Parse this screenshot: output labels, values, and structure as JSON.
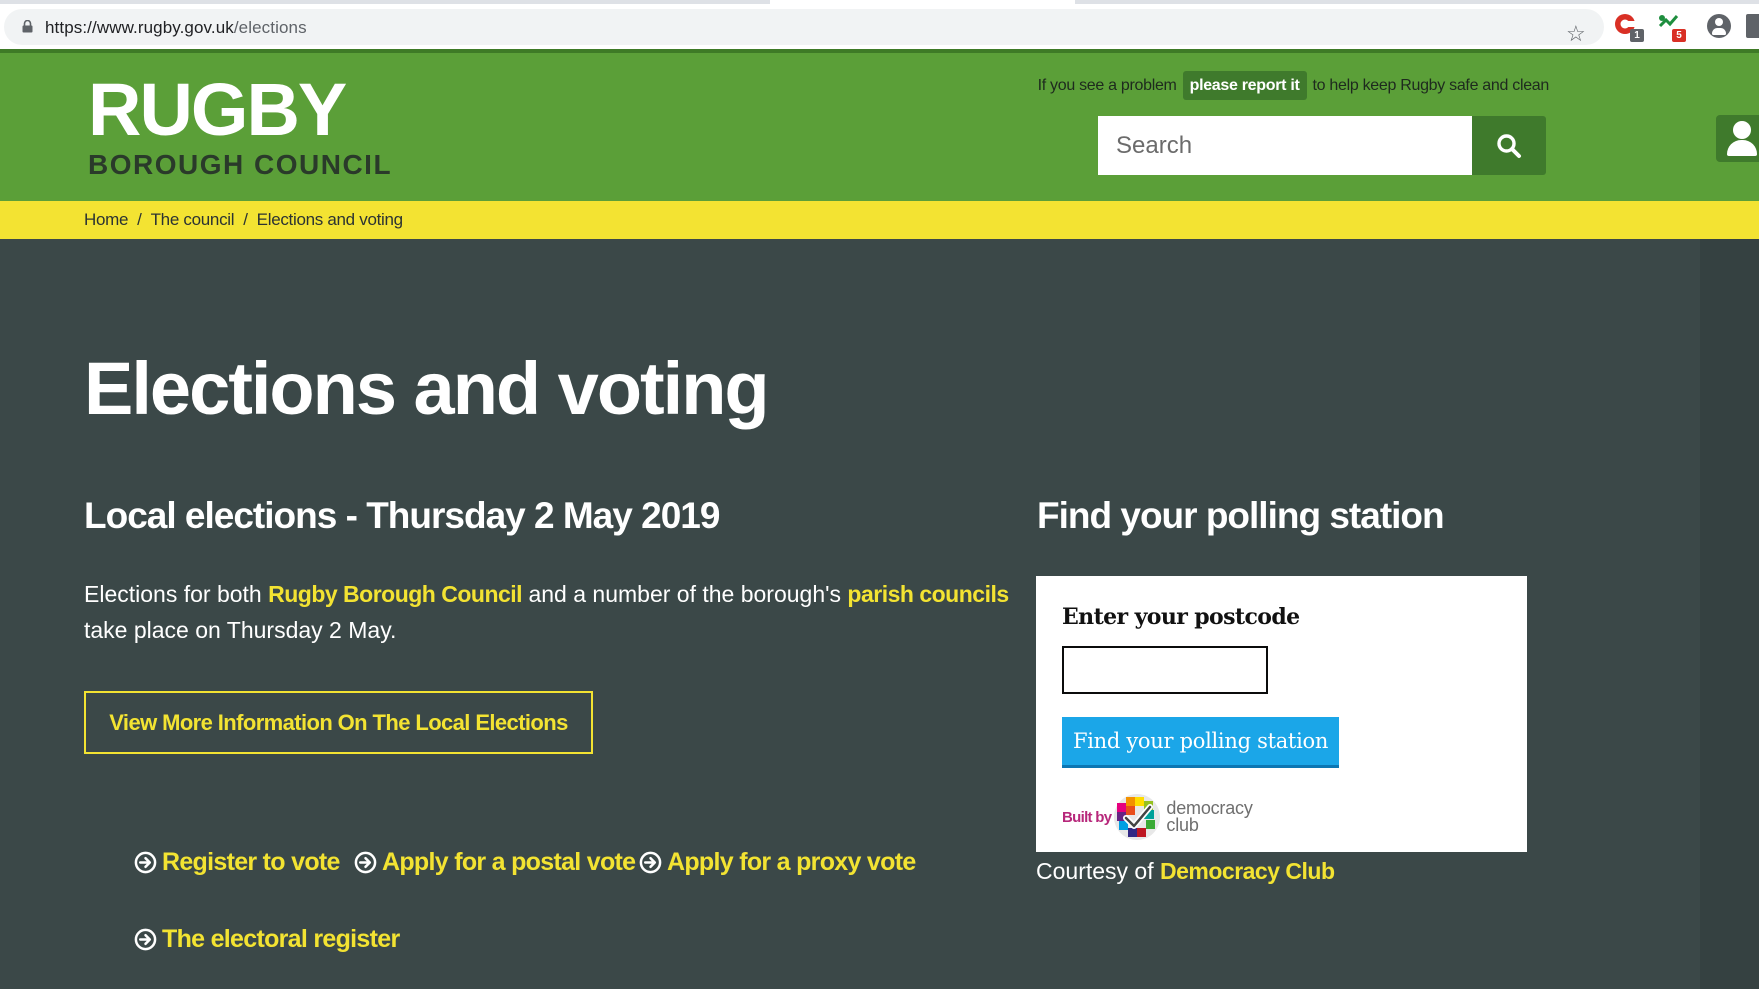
{
  "browser": {
    "url_host": "https://www.rugby.gov.uk",
    "url_path": "/elections",
    "ext1_badge": "1",
    "ext2_badge": "5"
  },
  "header": {
    "logo_main": "RUGBY",
    "logo_sub": "BOROUGH COUNCIL",
    "report_prefix": "If you see a problem",
    "report_button": "please report it",
    "report_suffix": "to help keep Rugby safe and clean",
    "search_placeholder": "Search"
  },
  "breadcrumb": {
    "items": [
      "Home",
      "The council",
      "Elections and voting"
    ],
    "separator": "/"
  },
  "main": {
    "title": "Elections and voting",
    "section_heading": "Local elections - Thursday 2 May 2019",
    "intro_part1": "Elections for both ",
    "intro_link1": "Rugby Borough Council",
    "intro_part2": " and a number of the borough's ",
    "intro_link2": "parish councils",
    "intro_part3": " take place on Thursday 2 May.",
    "more_button": "View More Information On The Local Elections",
    "quick_links": [
      "Register to vote",
      "Apply for a postal vote",
      "Apply for a proxy vote",
      "The electoral register"
    ]
  },
  "polling": {
    "heading": "Find your polling station",
    "input_label": "Enter your postcode",
    "button": "Find your polling station",
    "built_by": "Built by",
    "dc_line1": "democracy",
    "dc_line2": "club",
    "courtesy_prefix": "Courtesy of ",
    "courtesy_link": "Democracy Club"
  },
  "colors": {
    "header_green": "#5b9f38",
    "dark_green": "#3f7a2c",
    "breadcrumb_yellow": "#f3e332",
    "page_bg": "#3b4848",
    "link_yellow": "#f3e332",
    "poll_button_blue": "#1ba6e8"
  },
  "icons": [
    "lock-icon",
    "star-icon",
    "extension-icon",
    "profile-icon",
    "search-icon",
    "user-icon",
    "arrow-circle-right-icon",
    "democracy-club-logo-icon"
  ]
}
